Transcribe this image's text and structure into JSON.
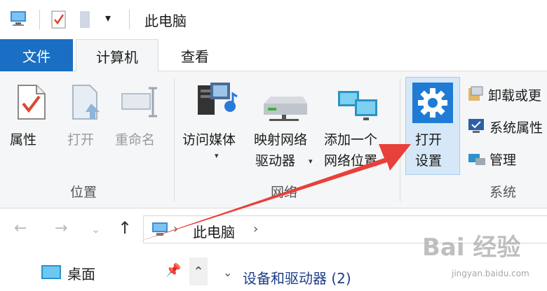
{
  "window": {
    "title": "此电脑",
    "dropdown_glyph": "▾"
  },
  "tabs": {
    "file": "文件",
    "computer": "计算机",
    "view": "查看"
  },
  "ribbon": {
    "location": {
      "properties": "属性",
      "open": "打开",
      "rename": "重命名",
      "group": "位置"
    },
    "network": {
      "access_media": "访问媒体",
      "map_drive_line1": "映射网络",
      "map_drive_line2": "驱动器",
      "add_location_line1": "添加一个",
      "add_location_line2": "网络位置",
      "group": "网络"
    },
    "system": {
      "open_settings_line1": "打开",
      "open_settings_line2": "设置",
      "uninstall": "卸载或更",
      "system_properties": "系统属性",
      "manage": "管理",
      "group": "系统"
    }
  },
  "address": {
    "path": "此电脑",
    "separator": "›"
  },
  "nav_pane": {
    "desktop": "桌面"
  },
  "content": {
    "section_title": "设备和驱动器 (2)"
  },
  "watermark": {
    "brand": "Bai 经验",
    "url": "jingyan.baidu.com"
  },
  "colors": {
    "accent": "#1a6fc4",
    "annotation_arrow": "#e8403a",
    "settings_highlight": "#d6e8f8"
  }
}
